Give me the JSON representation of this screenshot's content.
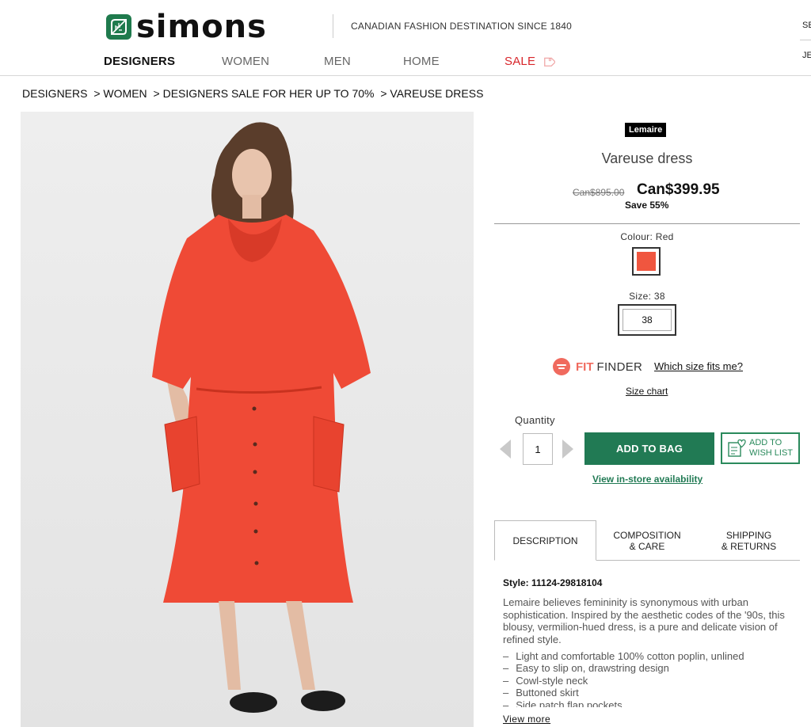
{
  "header": {
    "logo_text": "simons",
    "tagline": "CANADIAN FASHION DESTINATION SINCE 1840",
    "edge_text_1": "SE",
    "edge_text_2": "JE"
  },
  "nav": [
    {
      "label": "DESIGNERS"
    },
    {
      "label": "WOMEN"
    },
    {
      "label": "MEN"
    },
    {
      "label": "HOME"
    },
    {
      "label": "SALE"
    }
  ],
  "breadcrumb": [
    "DESIGNERS",
    "> WOMEN",
    "> DESIGNERS SALE FOR HER UP TO 70%",
    "> VAREUSE DRESS"
  ],
  "product": {
    "brand": "Lemaire",
    "name": "Vareuse dress",
    "old_price": "Can$895.00",
    "new_price": "Can$399.95",
    "save": "Save 55%",
    "colour_label": "Colour: Red",
    "colour_hex": "#f0563f",
    "size_label": "Size: 38",
    "size_value": "38",
    "dress_color": "#ef4a36"
  },
  "fit_finder": {
    "fit": "FIT",
    "finder": "FINDER",
    "which_size": "Which size fits me?",
    "size_chart": "Size chart"
  },
  "purchase": {
    "quantity_label": "Quantity",
    "quantity_value": "1",
    "add_to_bag": "ADD TO BAG",
    "wishlist_line1": "ADD TO",
    "wishlist_line2": "WISH LIST",
    "instore": "View in-store availability"
  },
  "tabs": {
    "description": "DESCRIPTION",
    "composition_1": "COMPOSITION",
    "composition_2": "& CARE",
    "shipping_1": "SHIPPING",
    "shipping_2": "& RETURNS"
  },
  "details": {
    "style": "Style: 11124-29818104",
    "description": "Lemaire believes femininity is synonymous with urban sophistication. Inspired by the aesthetic codes of the '90s, this blousy, vermilion-hued dress, is a pure and delicate vision of refined style.",
    "features": [
      "Light and comfortable 100% cotton poplin, unlined",
      "Easy to slip on, drawstring design",
      "Cowl-style neck",
      "Buttoned skirt",
      "Side patch flap pockets"
    ],
    "view_more": "View more"
  },
  "colors": {
    "brand_green": "#217a54",
    "sale_red": "#d8262b",
    "fit_finder_coral": "#f06a5e"
  }
}
